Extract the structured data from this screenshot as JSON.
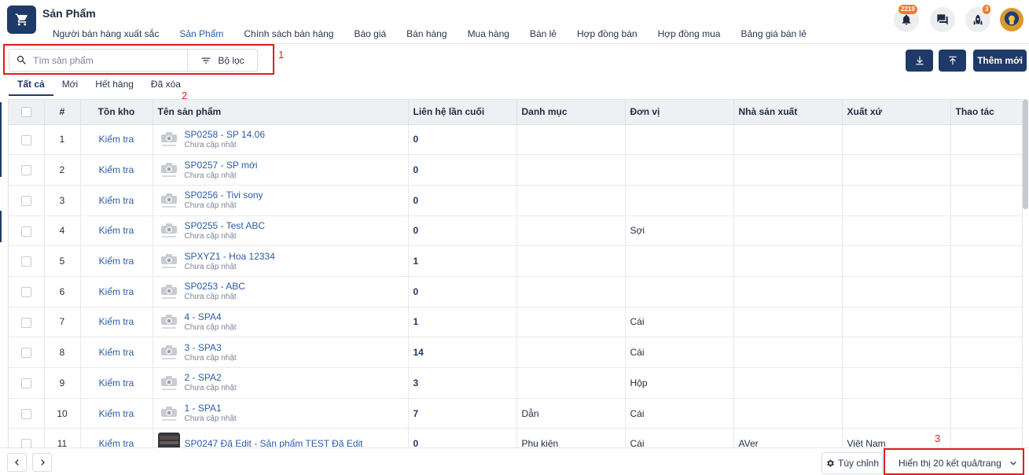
{
  "app": {
    "title": "Sản Phẩm"
  },
  "nav": {
    "items": [
      {
        "label": "Người bán hàng xuất sắc"
      },
      {
        "label": "Sản Phẩm"
      },
      {
        "label": "Chính sách bán hàng"
      },
      {
        "label": "Báo giá"
      },
      {
        "label": "Bán hàng"
      },
      {
        "label": "Mua hàng"
      },
      {
        "label": "Bán lẻ"
      },
      {
        "label": "Hợp đồng bán"
      },
      {
        "label": "Hợp đồng mua"
      },
      {
        "label": "Bảng giá bán lẻ"
      }
    ],
    "active_index": 1
  },
  "header": {
    "notifications_badge": "2219",
    "rocket_badge": "3"
  },
  "toolbar": {
    "search_placeholder": "Tìm sản phẩm",
    "filter_label": "Bộ lọc",
    "add_label": "Thêm mới"
  },
  "annotations": {
    "box1": "1",
    "box2": "2",
    "box3": "3"
  },
  "tabs": [
    {
      "label": "Tất cả"
    },
    {
      "label": "Mới"
    },
    {
      "label": "Hết hàng"
    },
    {
      "label": "Đã xóa"
    }
  ],
  "table": {
    "columns": [
      "#",
      "Tồn kho",
      "Tên sản phẩm",
      "Liên hệ lần cuối",
      "Danh mục",
      "Đơn vị",
      "Nhà sản xuất",
      "Xuất xứ",
      "Thao tác"
    ],
    "rows": [
      {
        "no": "1",
        "stock": "Kiểm tra",
        "name": "SP0258 - SP 14.06",
        "sub": "Chưa cập nhật",
        "contact": "0",
        "category": "",
        "unit": "",
        "maker": "",
        "origin": ""
      },
      {
        "no": "2",
        "stock": "Kiểm tra",
        "name": "SP0257 - SP mới",
        "sub": "Chưa cập nhật",
        "contact": "0",
        "category": "",
        "unit": "",
        "maker": "",
        "origin": ""
      },
      {
        "no": "3",
        "stock": "Kiểm tra",
        "name": "SP0256 - Tivi sony",
        "sub": "Chưa cập nhật",
        "contact": "0",
        "category": "",
        "unit": "",
        "maker": "",
        "origin": ""
      },
      {
        "no": "4",
        "stock": "Kiểm tra",
        "name": "SP0255 - Test ABC",
        "sub": "Chưa cập nhật",
        "contact": "0",
        "category": "",
        "unit": "Sợi",
        "maker": "",
        "origin": ""
      },
      {
        "no": "5",
        "stock": "Kiểm tra",
        "name": "SPXYZ1 - Hoa 12334",
        "sub": "Chưa cập nhật",
        "contact": "1",
        "category": "",
        "unit": "",
        "maker": "",
        "origin": ""
      },
      {
        "no": "6",
        "stock": "Kiểm tra",
        "name": "SP0253 - ABC",
        "sub": "Chưa cập nhật",
        "contact": "0",
        "category": "",
        "unit": "",
        "maker": "",
        "origin": ""
      },
      {
        "no": "7",
        "stock": "Kiểm tra",
        "name": "4 - SPA4",
        "sub": "Chưa cập nhật",
        "contact": "1",
        "category": "",
        "unit": "Cái",
        "maker": "",
        "origin": ""
      },
      {
        "no": "8",
        "stock": "Kiểm tra",
        "name": "3 - SPA3",
        "sub": "Chưa cập nhật",
        "contact": "14",
        "category": "",
        "unit": "Cái",
        "maker": "",
        "origin": ""
      },
      {
        "no": "9",
        "stock": "Kiểm tra",
        "name": "2 - SPA2",
        "sub": "Chưa cập nhật",
        "contact": "3",
        "category": "",
        "unit": "Hộp",
        "maker": "",
        "origin": ""
      },
      {
        "no": "10",
        "stock": "Kiểm tra",
        "name": "1 - SPA1",
        "sub": "Chưa cập nhật",
        "contact": "7",
        "category": "Dẫn",
        "unit": "Cái",
        "maker": "",
        "origin": ""
      },
      {
        "no": "11",
        "stock": "Kiểm tra",
        "name": "SP0247 Đã Edit - Sản phẩm TEST Đã Edit",
        "sub": "",
        "contact": "0",
        "category": "Phụ kiện",
        "unit": "Cái",
        "maker": "AVer",
        "origin": "Việt Nam"
      }
    ]
  },
  "footer": {
    "customize_label": "Tùy chỉnh",
    "page_size_label": "Hiển thị 20 kết quả/trang"
  },
  "colors": {
    "primary": "#1f3a68",
    "link": "#2c5ba7",
    "badge": "#f07a2b",
    "annotation": "#e11d1d"
  }
}
